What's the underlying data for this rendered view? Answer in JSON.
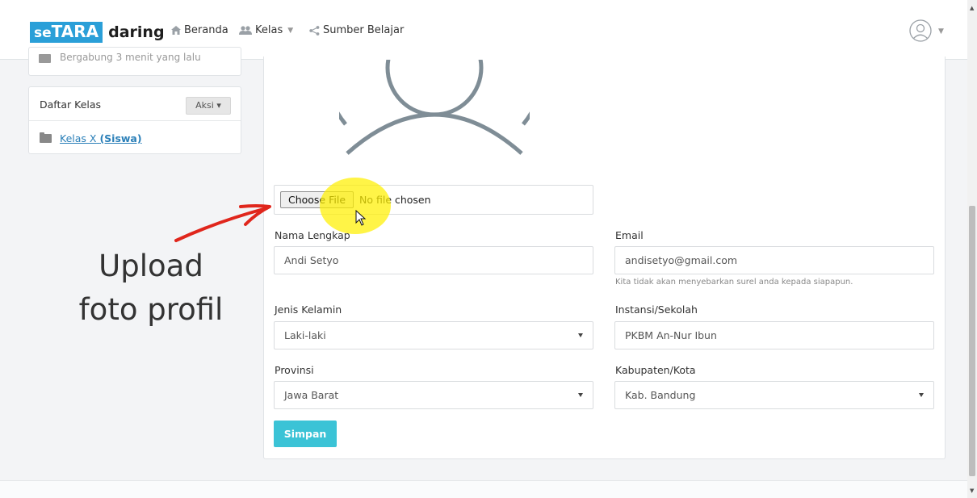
{
  "brand": {
    "box_text_small": "se",
    "box_text_big": "TARA",
    "word": "daring",
    "color": "#2a9fd8"
  },
  "nav": {
    "home": "Beranda",
    "classes": "Kelas",
    "resources": "Sumber Belajar"
  },
  "sidebar": {
    "joined_text": "Bergabung 3 menit yang lalu",
    "class_list_title": "Daftar Kelas",
    "action_label": "Aksi",
    "class_item_name": "Kelas X",
    "class_item_role": "(Siswa)"
  },
  "file_upload": {
    "button_label": "Choose File",
    "status": "No file chosen"
  },
  "form": {
    "full_name_label": "Nama Lengkap",
    "full_name_value": "Andi Setyo",
    "email_label": "Email",
    "email_value": "andisetyo@gmail.com",
    "email_help": "Kita tidak akan menyebarkan surel anda kepada siapapun.",
    "gender_label": "Jenis Kelamin",
    "gender_value": "Laki-laki",
    "institution_label": "Instansi/Sekolah",
    "institution_value": "PKBM An-Nur Ibun",
    "province_label": "Provinsi",
    "province_value": "Jawa Barat",
    "city_label": "Kabupaten/Kota",
    "city_value": "Kab. Bandung",
    "save_label": "Simpan"
  },
  "annotation": {
    "line1": "Upload",
    "line2": "foto profil"
  },
  "colors": {
    "accent": "#3bc3d6",
    "link": "#2a7fb8",
    "arrow": "#e0261c",
    "highlight": "#fff000"
  }
}
